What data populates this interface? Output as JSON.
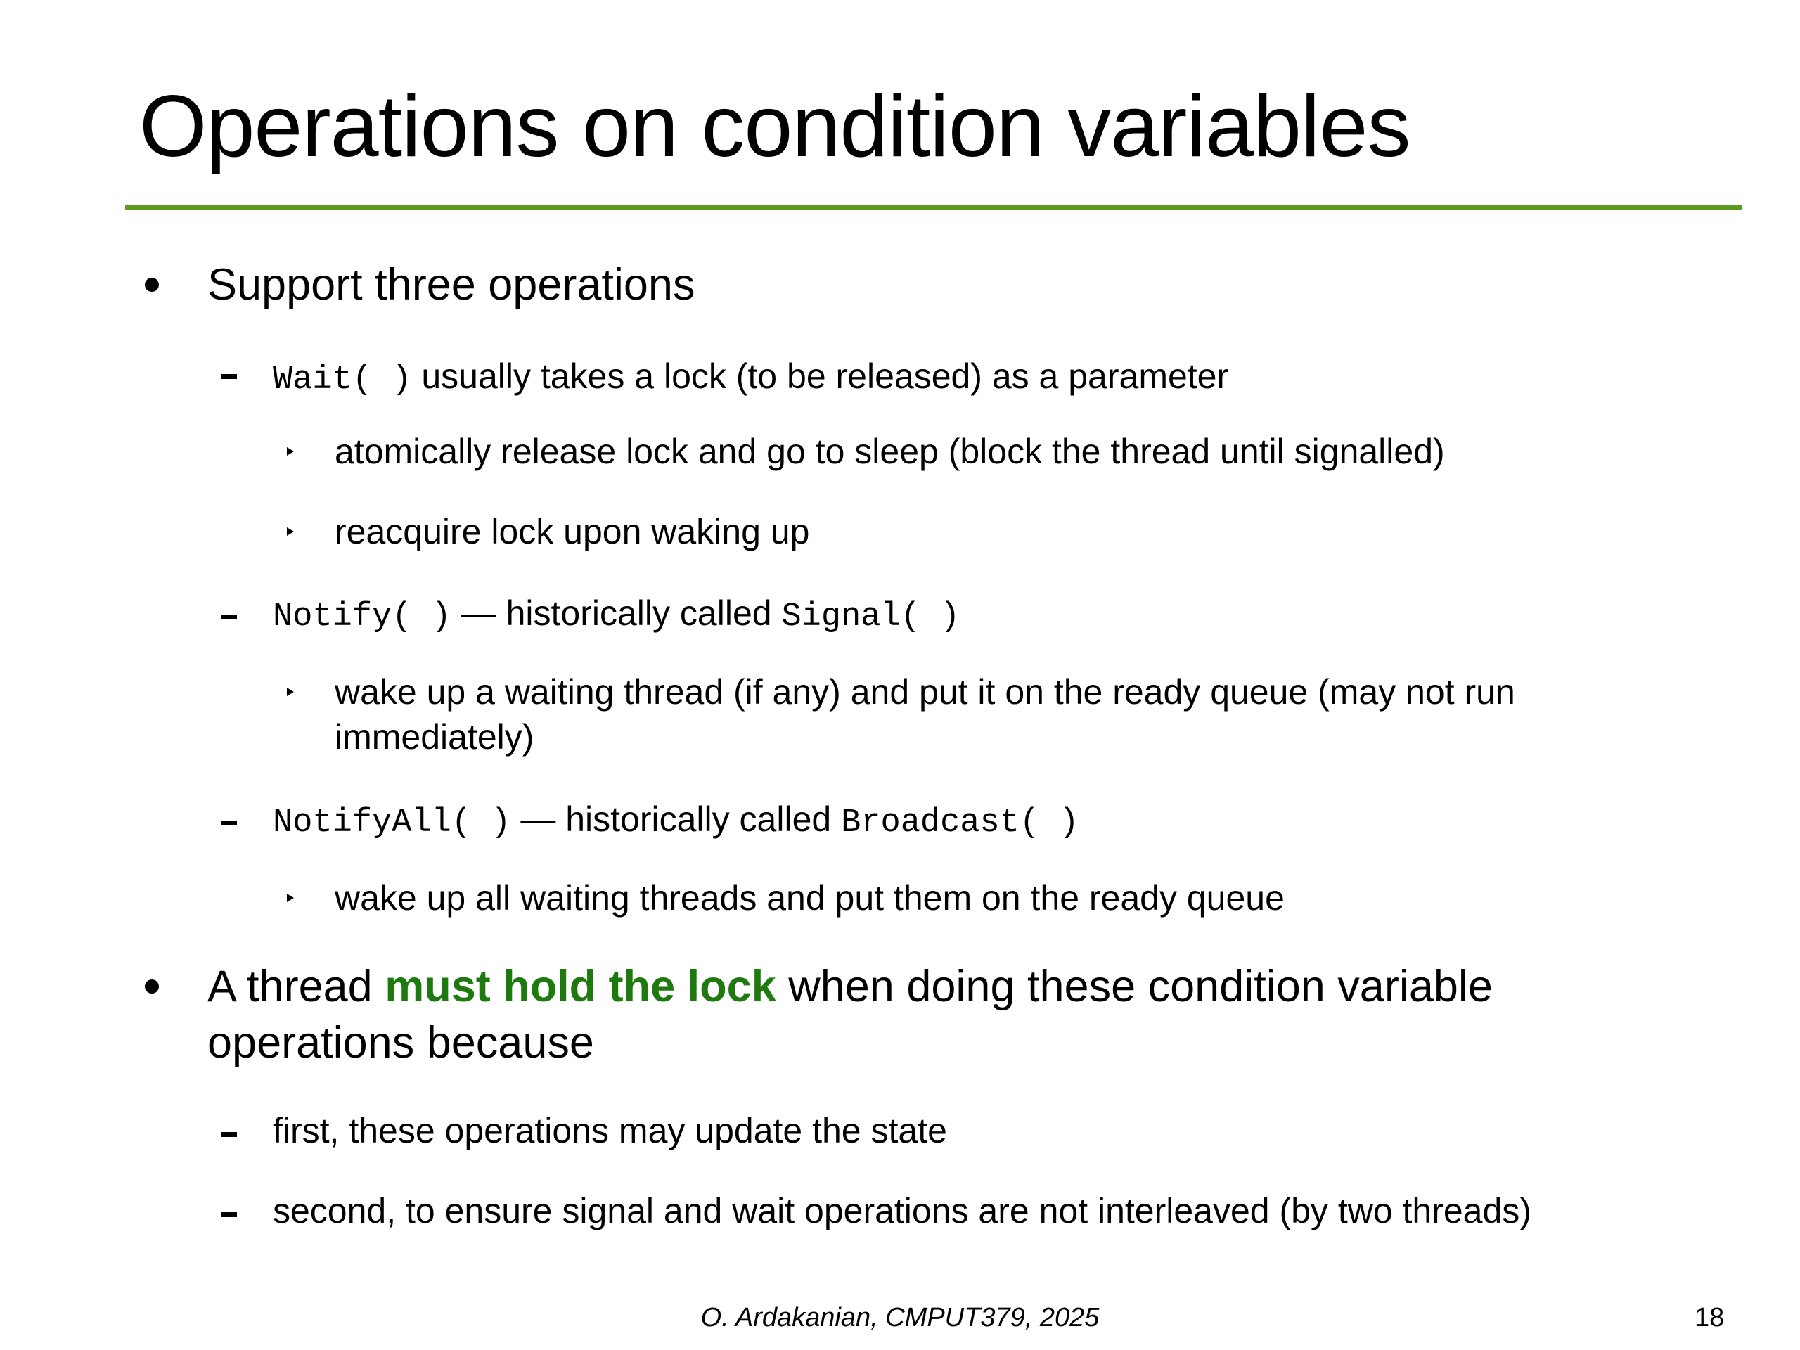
{
  "slide": {
    "title": "Operations on condition variables",
    "accent_color": "#5a9a1e",
    "highlight_color": "#1e7a0f",
    "bullet1": {
      "text": "Support three operations",
      "wait": {
        "code": "Wait( )",
        "text": " usually takes a lock (to be released) as a parameter",
        "sub1": "atomically release lock and go to sleep (block the thread until signalled)",
        "sub2": "reacquire lock upon waking up"
      },
      "notify": {
        "code": "Notify( )",
        "text": " — historically called ",
        "alt_code": "Signal( )",
        "sub1_line1": "wake up a waiting thread (if any) and put it on the ready queue (may not run",
        "sub1_line2": "immediately)"
      },
      "notify_all": {
        "code": "NotifyAll( )",
        "text": " — historically called ",
        "alt_code": "Broadcast( )",
        "sub1": "wake up all waiting threads and put them on the ready queue"
      }
    },
    "bullet2": {
      "pre": "A thread ",
      "highlight": "must hold the lock",
      "post": " when doing these condition variable",
      "line2": "operations because",
      "sub1": "first, these operations may update the state",
      "sub2": "second, to ensure signal and wait operations are not interleaved (by two threads)"
    }
  },
  "footer": {
    "credit": "O. Ardakanian, CMPUT379, 2025",
    "page_number": "18"
  }
}
